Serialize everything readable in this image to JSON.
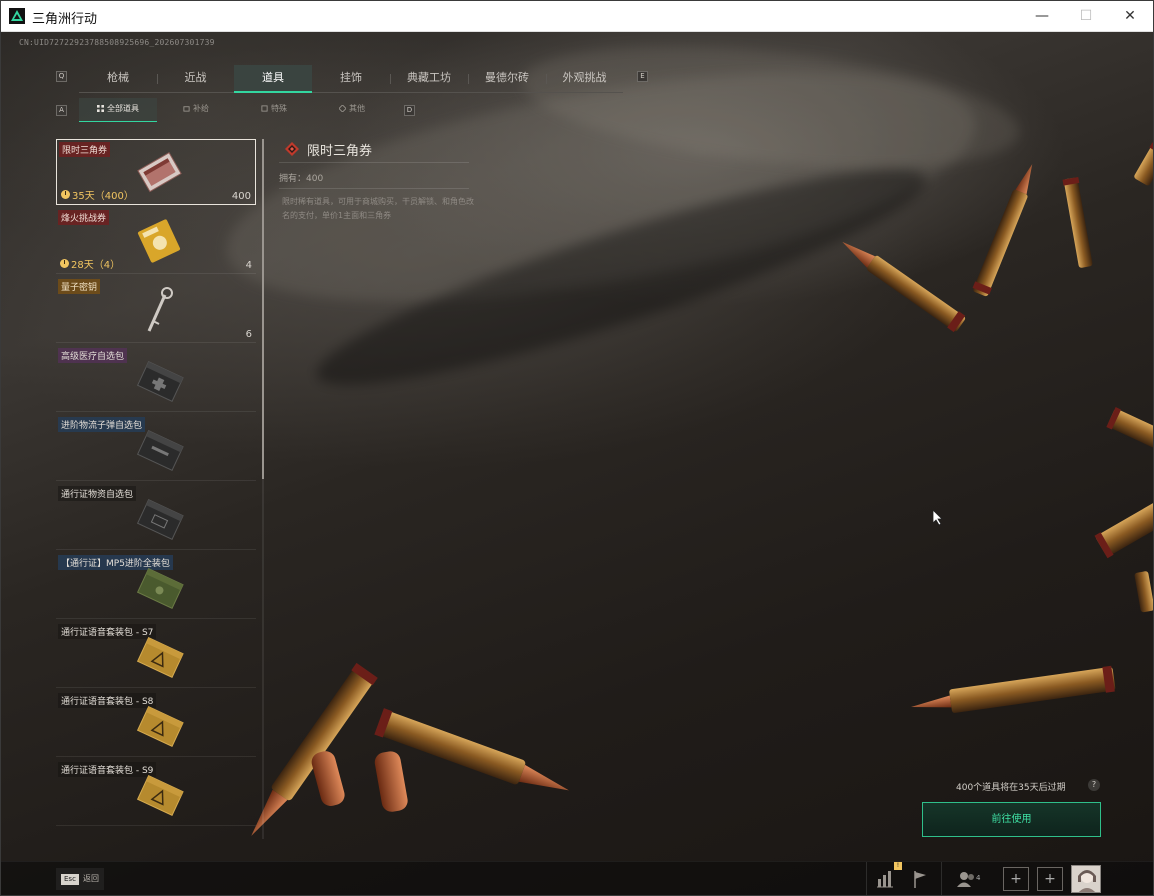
{
  "window": {
    "title": "三角洲行动",
    "minimize": "—",
    "maximize": "☐",
    "close": "✕"
  },
  "uid_line": "CN:UID72722923788508925696_202607301739",
  "hints": {
    "prev_tab": "Q",
    "next_tab": "E",
    "prev_sub": "A",
    "next_sub": "D"
  },
  "main_tabs": [
    {
      "label": "枪械",
      "active": false
    },
    {
      "label": "近战",
      "active": false
    },
    {
      "label": "道具",
      "active": true
    },
    {
      "label": "挂饰",
      "active": false
    },
    {
      "label": "典藏工坊",
      "active": false
    },
    {
      "label": "曼德尔砖",
      "active": false
    },
    {
      "label": "外观挑战",
      "active": false
    }
  ],
  "sub_tabs": [
    {
      "label": "全部道具",
      "active": true,
      "icon": "grid-icon"
    },
    {
      "label": "补给",
      "active": false,
      "icon": "supply-icon"
    },
    {
      "label": "特殊",
      "active": false,
      "icon": "special-icon"
    },
    {
      "label": "其他",
      "active": false,
      "icon": "diamond-icon"
    }
  ],
  "items": [
    {
      "name": "限时三角券",
      "name_style": "red",
      "timer": "35天（400）",
      "count": "400",
      "selected": true,
      "img": "ticket"
    },
    {
      "name": "烽火挑战券",
      "name_style": "red",
      "timer": "28天（4）",
      "count": "4",
      "selected": false,
      "img": "gold-ticket"
    },
    {
      "name": "量子密钥",
      "name_style": "gold",
      "timer": "",
      "count": "6",
      "selected": false,
      "img": "key"
    },
    {
      "name": "高级医疗自选包",
      "name_style": "purple",
      "timer": "",
      "count": "",
      "selected": false,
      "img": "black-box"
    },
    {
      "name": "进阶物流子弹自选包",
      "name_style": "blue",
      "timer": "",
      "count": "",
      "selected": false,
      "img": "black-box"
    },
    {
      "name": "通行证物资自选包",
      "name_style": "plain",
      "timer": "",
      "count": "",
      "selected": false,
      "img": "black-box"
    },
    {
      "name": "【通行证】MP5进阶全装包",
      "name_style": "blue",
      "timer": "",
      "count": "",
      "selected": false,
      "img": "green-box"
    },
    {
      "name": "通行证语音套装包 - S7",
      "name_style": "plain",
      "timer": "",
      "count": "",
      "selected": false,
      "img": "gold-box"
    },
    {
      "name": "通行证语音套装包 - S8",
      "name_style": "plain",
      "timer": "",
      "count": "",
      "selected": false,
      "img": "gold-box"
    },
    {
      "name": "通行证语音套装包 - S9",
      "name_style": "plain",
      "timer": "",
      "count": "",
      "selected": false,
      "img": "gold-box"
    }
  ],
  "detail": {
    "title": "限时三角券",
    "owned": "拥有：400",
    "description": "限时稀有道具，可用于商城购买，干员解锁、和角色改名的支付，单价1主面和三角券"
  },
  "expire_note": "400个道具将在35天后过期",
  "help": "?",
  "use_button": "前往使用",
  "footer": {
    "esc_key": "Esc",
    "esc_label": "返回",
    "badge": "!",
    "social_count": "4",
    "plus": "+"
  },
  "colors": {
    "accent": "#33d6a0",
    "timer": "#f1c560",
    "rare_red": "#702020"
  }
}
